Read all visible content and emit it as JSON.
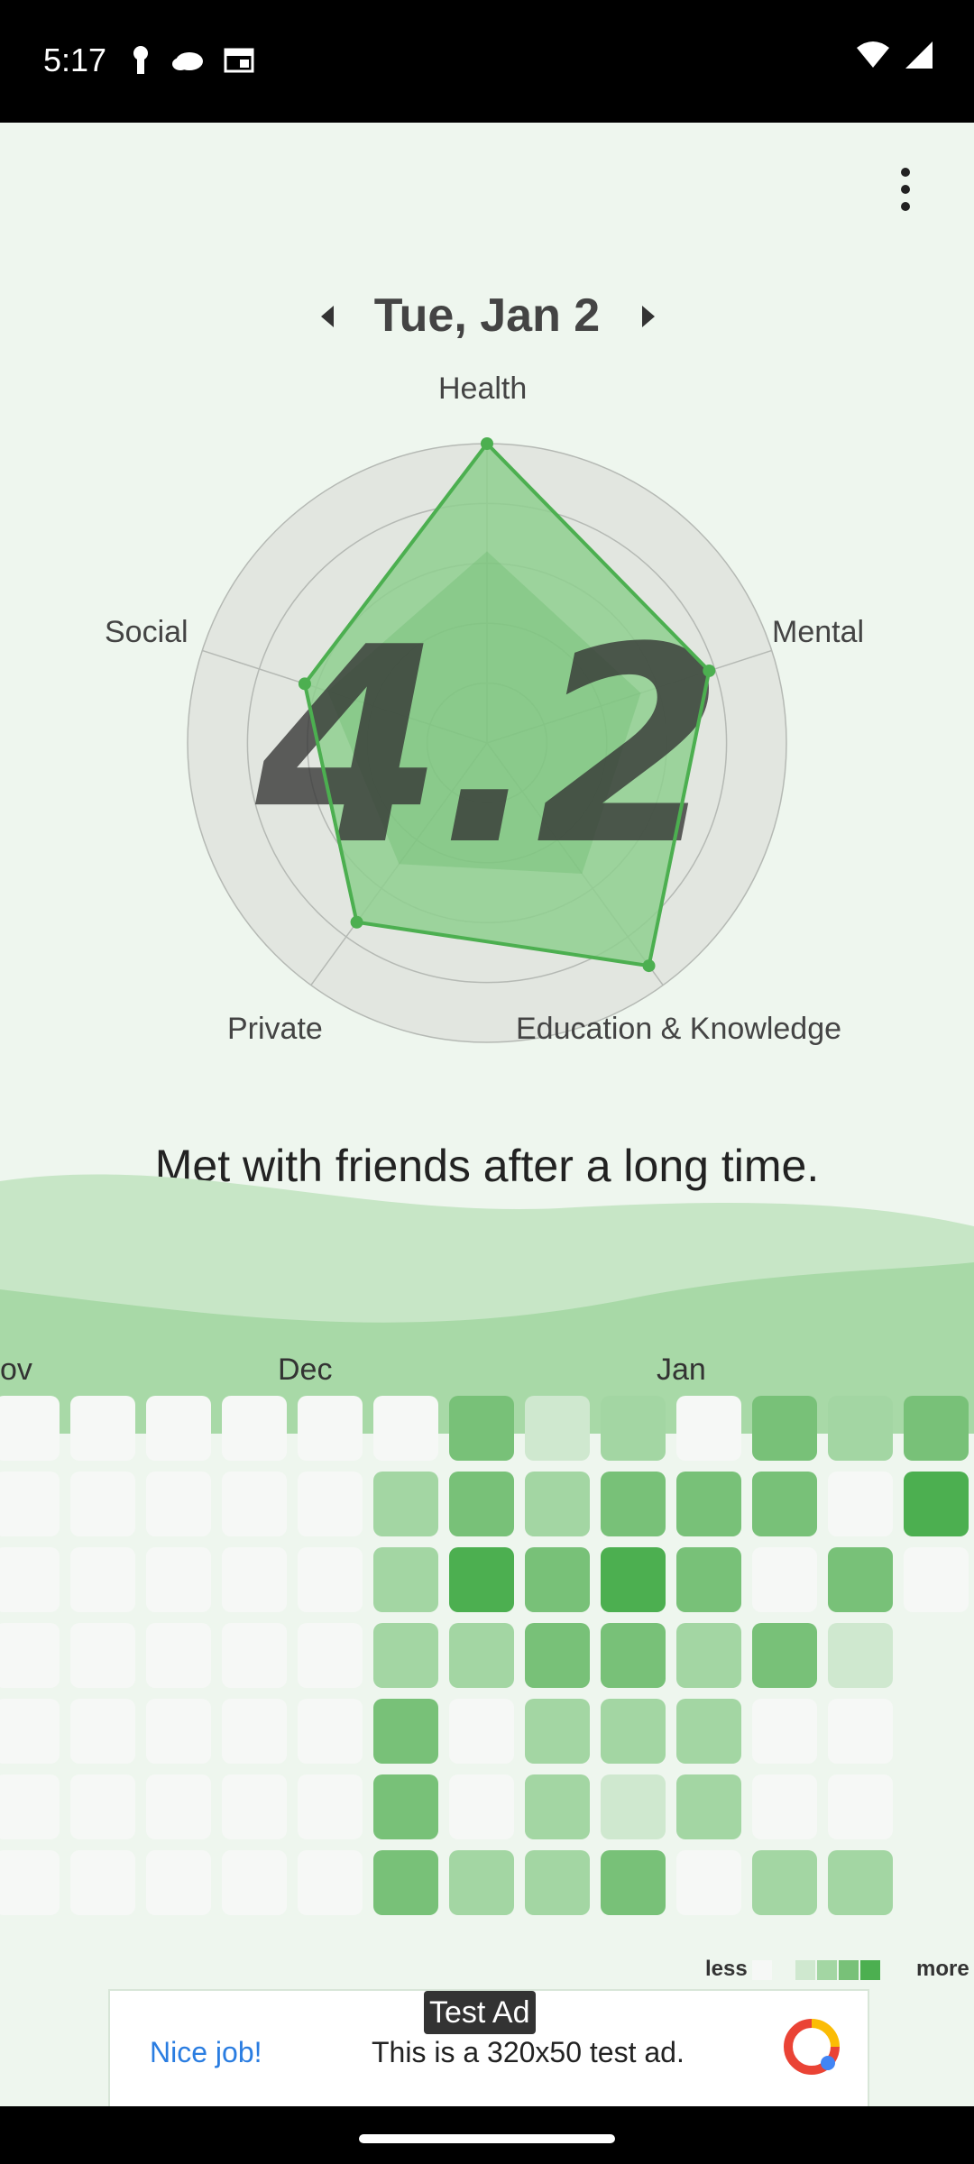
{
  "status_bar": {
    "time": "5:17"
  },
  "date_nav": {
    "title": "Tue, Jan 2"
  },
  "radar": {
    "score": "4.2",
    "axes": [
      "Health",
      "Mental",
      "Education & Knowledge",
      "Private",
      "Social"
    ],
    "max": 5,
    "today": [
      5,
      3.9,
      4.6,
      3.7,
      3.2
    ],
    "average": [
      3.2,
      2.7,
      2.7,
      2.5,
      2.8
    ],
    "colors": {
      "accent": "#4caf50",
      "fill": "#8fcf8f",
      "ring": "#e2e6e0",
      "score": "#333333"
    }
  },
  "note": "Met with friends after a long time.",
  "heatmap": {
    "months": [
      "ov",
      "Dec",
      "Jan"
    ],
    "levels": [
      [
        0,
        0,
        0,
        0,
        0,
        0,
        0
      ],
      [
        0,
        0,
        0,
        0,
        0,
        0,
        0
      ],
      [
        0,
        0,
        0,
        0,
        0,
        0,
        0
      ],
      [
        0,
        0,
        0,
        0,
        0,
        0,
        0
      ],
      [
        0,
        0,
        0,
        0,
        0,
        0,
        0
      ],
      [
        0,
        2,
        2,
        2,
        3,
        3,
        3
      ],
      [
        3,
        3,
        4,
        2,
        0,
        0,
        2
      ],
      [
        1,
        2,
        3,
        3,
        2,
        2,
        2
      ],
      [
        2,
        3,
        4,
        3,
        2,
        1,
        3
      ],
      [
        0,
        3,
        3,
        2,
        2,
        2,
        0
      ],
      [
        3,
        3,
        0,
        3,
        0,
        0,
        2
      ],
      [
        2,
        0,
        3,
        1,
        0,
        0,
        2
      ],
      [
        3,
        4,
        0,
        null,
        null,
        null,
        null
      ]
    ],
    "legend": {
      "less": "less",
      "more": "more"
    },
    "colors": [
      "#f6f8f6",
      "#cfe8cf",
      "#a3d6a3",
      "#78c178",
      "#4caf50"
    ]
  },
  "ad": {
    "badge": "Test Ad",
    "cta": "Nice job!",
    "text": "This is a 320x50 test ad."
  }
}
